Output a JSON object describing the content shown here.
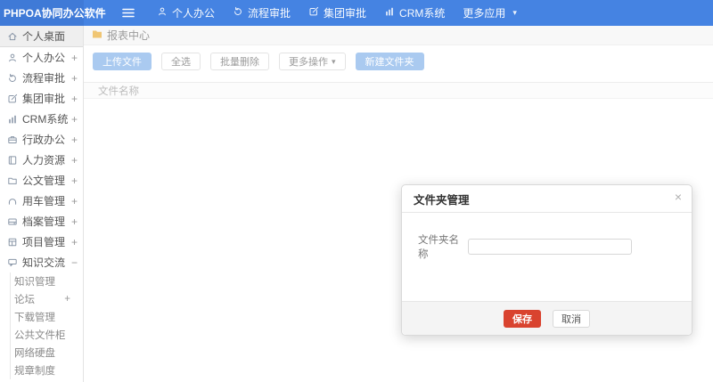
{
  "app": {
    "title": "PHPOA协同办公软件"
  },
  "colors": {
    "navbar": "#4583e2",
    "navbar_dark": "#3f7ad7",
    "primary_light": "#aacaf0",
    "save_red": "#d9432f",
    "folder_yellow": "#f0c674"
  },
  "topnav": {
    "items": [
      {
        "name": "personal-office",
        "icon": "user",
        "label": "个人办公",
        "caret": false
      },
      {
        "name": "process-approval",
        "icon": "process",
        "label": "流程审批",
        "caret": false
      },
      {
        "name": "group-approval",
        "icon": "edit",
        "label": "集团审批",
        "caret": false
      },
      {
        "name": "crm-system",
        "icon": "chart",
        "label": "CRM系统",
        "caret": false
      },
      {
        "name": "more-apps",
        "icon": "",
        "label": "更多应用",
        "caret": true
      }
    ]
  },
  "sidebar": {
    "items": [
      {
        "name": "personal-desktop",
        "icon": "home",
        "label": "个人桌面",
        "expand": "",
        "active": true
      },
      {
        "name": "personal-office",
        "icon": "user",
        "label": "个人办公",
        "expand": "+",
        "active": false
      },
      {
        "name": "process-approval",
        "icon": "process",
        "label": "流程审批",
        "expand": "+",
        "active": false
      },
      {
        "name": "group-approval",
        "icon": "edit",
        "label": "集团审批",
        "expand": "+",
        "active": false
      },
      {
        "name": "crm-system",
        "icon": "chart",
        "label": "CRM系统",
        "expand": "+",
        "active": false
      },
      {
        "name": "admin-office",
        "icon": "briefcase",
        "label": "行政办公",
        "expand": "+",
        "active": false
      },
      {
        "name": "human-resources",
        "icon": "book",
        "label": "人力资源",
        "expand": "+",
        "active": false
      },
      {
        "name": "document-mgmt",
        "icon": "folder",
        "label": "公文管理",
        "expand": "+",
        "active": false
      },
      {
        "name": "vehicle-mgmt",
        "icon": "headset",
        "label": "用车管理",
        "expand": "+",
        "active": false
      },
      {
        "name": "archive-mgmt",
        "icon": "drive",
        "label": "档案管理",
        "expand": "+",
        "active": false
      },
      {
        "name": "project-mgmt",
        "icon": "project",
        "label": "项目管理",
        "expand": "+",
        "active": false
      },
      {
        "name": "knowledge-exchange",
        "icon": "chat",
        "label": "知识交流",
        "expand": "−",
        "active": false,
        "children": [
          {
            "name": "knowledge-mgmt",
            "label": "知识管理",
            "expand": ""
          },
          {
            "name": "forum",
            "label": "论坛",
            "expand": "+"
          },
          {
            "name": "download-mgmt",
            "label": "下载管理",
            "expand": ""
          },
          {
            "name": "public-cabinet",
            "label": "公共文件柜",
            "expand": ""
          },
          {
            "name": "network-disk",
            "label": "网络硬盘",
            "expand": ""
          },
          {
            "name": "rules-regulations",
            "label": "规章制度",
            "expand": ""
          }
        ]
      }
    ]
  },
  "breadcrumb": {
    "label": "报表中心"
  },
  "toolbar": {
    "buttons": [
      {
        "name": "upload-file",
        "label": "上传文件",
        "style": "primary",
        "caret": false
      },
      {
        "name": "select-all",
        "label": "全选",
        "style": "default",
        "caret": false
      },
      {
        "name": "batch-delete",
        "label": "批量删除",
        "style": "default",
        "caret": false
      },
      {
        "name": "more-actions",
        "label": "更多操作",
        "style": "default",
        "caret": true
      },
      {
        "name": "new-folder",
        "label": "新建文件夹",
        "style": "primary",
        "caret": false
      }
    ]
  },
  "table": {
    "columns": [
      "文件名称"
    ]
  },
  "modal": {
    "title": "文件夹管理",
    "close": "×",
    "field_label": "文件夹名称",
    "input_value": "",
    "save_label": "保存",
    "cancel_label": "取消"
  }
}
